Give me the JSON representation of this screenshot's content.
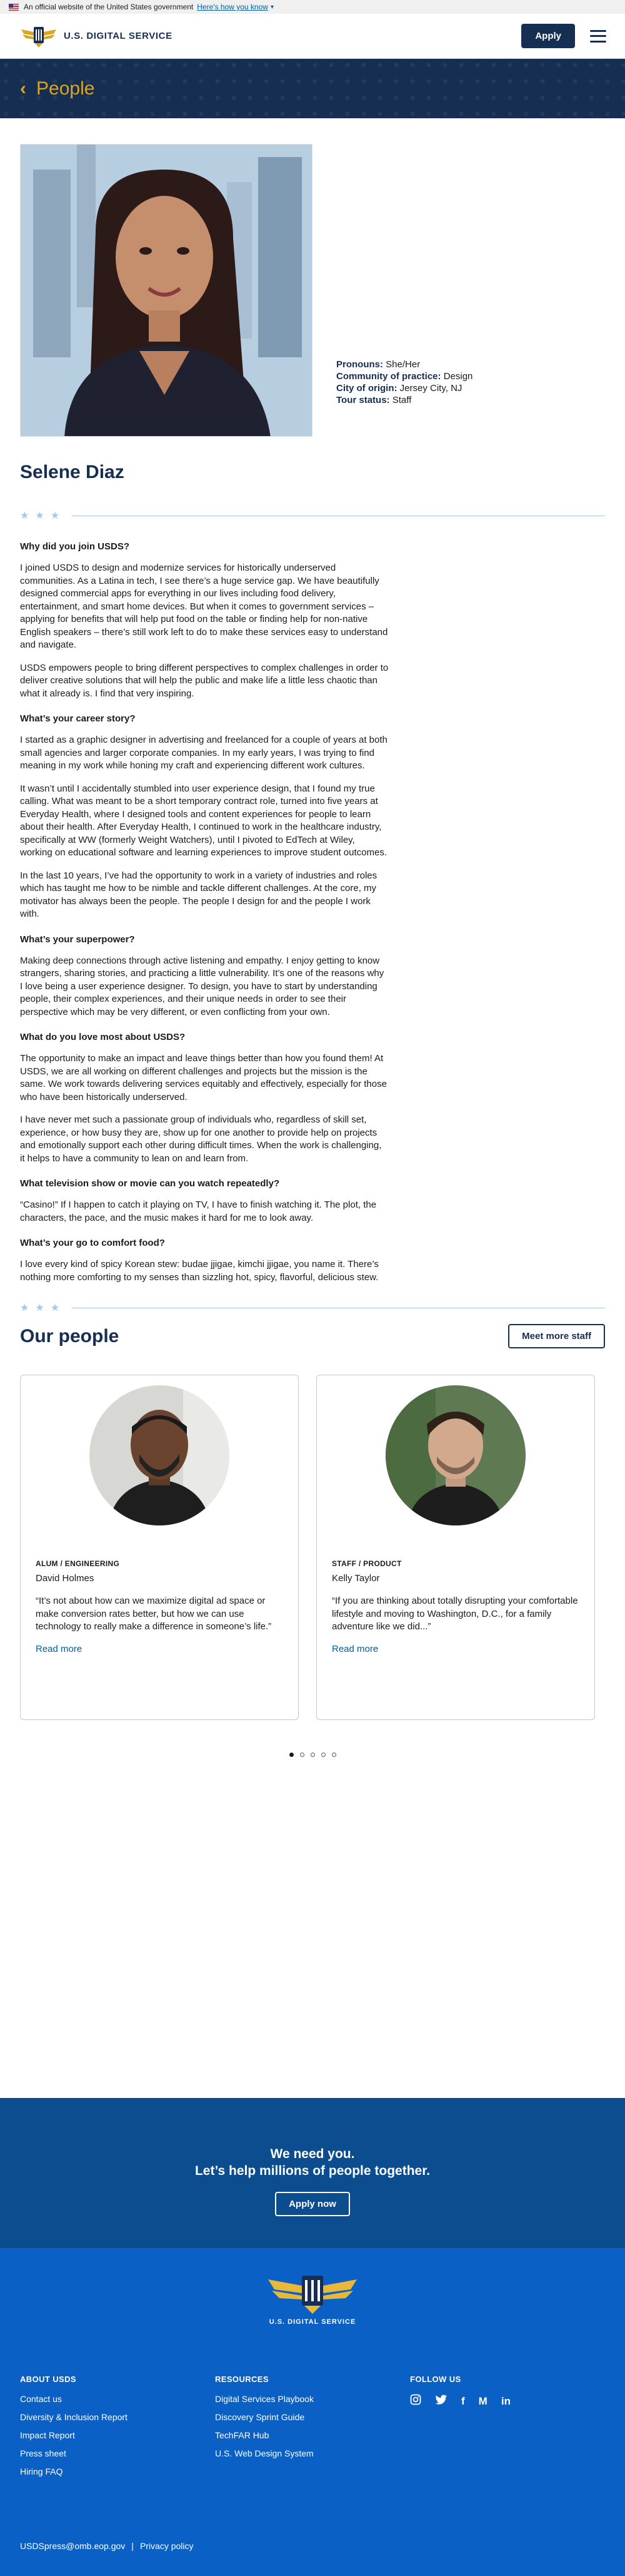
{
  "gov_banner": {
    "text": "An official website of the United States government",
    "link": "Here's how you know"
  },
  "header": {
    "logo_text": "U.S. DIGITAL SERVICE",
    "apply_label": "Apply"
  },
  "hero": {
    "title": "People"
  },
  "profile": {
    "name": "Selene Diaz",
    "meta": [
      {
        "key": "Pronouns:",
        "value": "She/Her"
      },
      {
        "key": "Community of practice:",
        "value": "Design"
      },
      {
        "key": "City of origin:",
        "value": "Jersey City, NJ"
      },
      {
        "key": "Tour status:",
        "value": "Staff"
      }
    ],
    "qa": [
      {
        "q": "Why did you join USDS?",
        "a": [
          "I joined USDS to design and modernize services for historically underserved communities. As a Latina in tech, I see there’s a huge service gap. We have beautifully designed commercial apps for everything in our lives including food delivery, entertainment, and smart home devices. But when it comes to government services – applying for benefits that will help put food on the table or finding help for non-native English speakers – there’s still work left to do to make these services easy to understand and navigate.",
          "USDS empowers people to bring different perspectives to complex challenges in order to deliver creative solutions that will help the public and make life a little less chaotic than what it already is. I find that very inspiring."
        ]
      },
      {
        "q": "What’s your career story?",
        "a": [
          "I started as a graphic designer in advertising and freelanced for a couple of years at both small agencies and larger corporate companies. In my early years, I was trying to find meaning in my work while honing my craft and experiencing different work cultures.",
          "It wasn’t until I accidentally stumbled into user experience design, that I found my true calling. What was meant to be a short temporary contract role, turned into five years at Everyday Health, where I designed tools and content experiences for people to learn about their health. After Everyday Health, I continued to work in the healthcare industry, specifically at WW (formerly Weight Watchers), until I pivoted to EdTech at Wiley, working on educational software and learning experiences to improve student outcomes.",
          "In the last 10 years, I’ve had the opportunity to work in a variety of industries and roles which has taught me how to be nimble and tackle different challenges. At the core, my motivator has always been the people. The people I design for and the people I work with."
        ]
      },
      {
        "q": "What’s your superpower?",
        "a": [
          "Making deep connections through active listening and empathy. I enjoy getting to know strangers, sharing stories, and practicing a little vulnerability. It’s one of the reasons why I love being a user experience designer. To design, you have to start by understanding people, their complex experiences, and their unique needs in order to see their perspective which may be very different, or even conflicting from your own."
        ]
      },
      {
        "q": "What do you love most about USDS?",
        "a": [
          "The opportunity to make an impact and leave things better than how you found them! At USDS, we are all working on different challenges and projects but the mission is the same. We work towards delivering services equitably and effectively, especially for those who have been historically underserved.",
          "I have never met such a passionate group of individuals who, regardless of skill set, experience, or how busy they are, show up for one another to provide help on projects and emotionally support each other during difficult times. When the work is challenging, it helps to have a community to lean on and learn from."
        ]
      },
      {
        "q": "What television show or movie can you watch repeatedly?",
        "a": [
          "“Casino!” If I happen to catch it playing on TV, I have to finish watching it. The plot, the characters, the pace, and the music makes it hard for me to look away."
        ]
      },
      {
        "q": "What’s your go to comfort food?",
        "a": [
          "I love every kind of spicy Korean stew: budae jjigae, kimchi jjigae, you name it. There’s nothing more comforting to my senses than sizzling hot, spicy, flavorful, delicious stew."
        ]
      }
    ]
  },
  "our_people": {
    "title": "Our people",
    "more_label": "Meet more staff",
    "cards": [
      {
        "role": "ALUM / ENGINEERING",
        "name": "David Holmes",
        "quote": "“It’s not about how can we maximize digital ad space or make conversion rates better, but how we can use technology to really make a difference in someone’s life.”",
        "link": "Read more"
      },
      {
        "role": "STAFF / PRODUCT",
        "name": "Kelly Taylor",
        "quote": "“If you are thinking about totally disrupting your comfortable lifestyle and moving to Washington, D.C., for a family adventure like we did...”",
        "link": "Read more"
      }
    ],
    "dots": 5,
    "active_dot": 0
  },
  "cta": {
    "line1": "We need you.",
    "line2": "Let’s help millions of people together.",
    "button": "Apply now"
  },
  "footer": {
    "logo_text": "U.S. DIGITAL SERVICE",
    "about": {
      "title": "ABOUT USDS",
      "links": [
        "Contact us",
        "Diversity & Inclusion Report",
        "Impact Report",
        "Press sheet",
        "Hiring FAQ"
      ]
    },
    "resources": {
      "title": "RESOURCES",
      "links": [
        "Digital Services Playbook",
        "Discovery Sprint Guide",
        "TechFAR Hub",
        "U.S. Web Design System"
      ]
    },
    "follow": {
      "title": "FOLLOW US",
      "icons": [
        "instagram-icon",
        "twitter-icon",
        "facebook-icon",
        "medium-icon",
        "linkedin-icon"
      ]
    },
    "email": "USDSpress@omb.eop.gov",
    "separator": "|",
    "privacy": "Privacy policy"
  }
}
